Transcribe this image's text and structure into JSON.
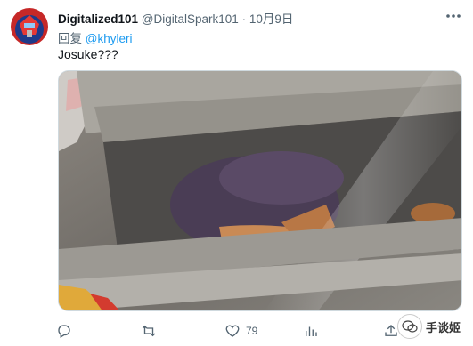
{
  "tweet": {
    "display_name": "Digitalized101",
    "handle": "@DigitalSpark101",
    "separator": "·",
    "date": "10月9日",
    "reply_prefix": "回复",
    "reply_to": "@khyleri",
    "text": "Josuke???"
  },
  "actions": {
    "like_count": "79"
  },
  "watermark": {
    "text": "手谈姬"
  },
  "colors": {
    "link": "#1d9bf0",
    "muted": "#536471",
    "text": "#0f1419"
  }
}
